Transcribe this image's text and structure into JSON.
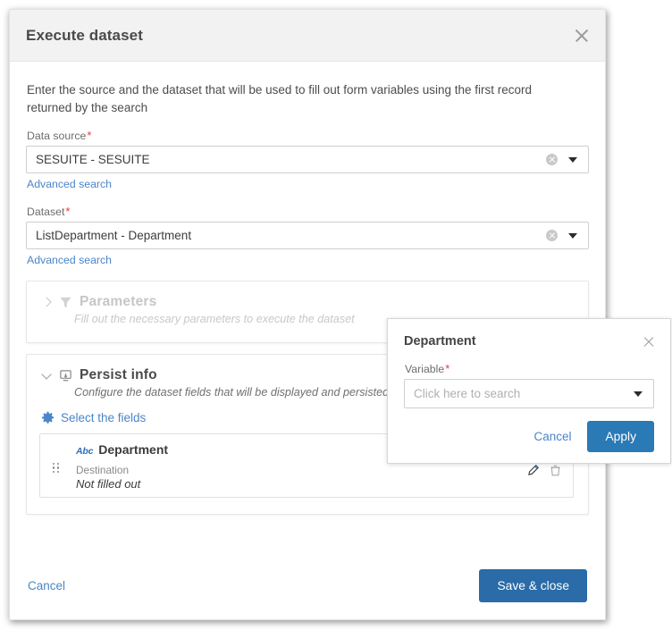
{
  "dialog": {
    "title": "Execute dataset",
    "close_icon": "close-icon",
    "intro": "Enter the source and the dataset that will be used to fill out form variables using the first record returned by the search",
    "fields": [
      {
        "label": "Data source",
        "required": "*",
        "value": "SESUITE - SESUITE",
        "clear_icon": "clear-circle-icon",
        "caret_icon": "chevron-down-icon",
        "advanced_search": "Advanced search"
      },
      {
        "label": "Dataset",
        "required": "*",
        "value": "ListDepartment - Department",
        "clear_icon": "clear-circle-icon",
        "caret_icon": "chevron-down-icon",
        "advanced_search": "Advanced search"
      }
    ],
    "sections": [
      {
        "title": "Parameters",
        "subtitle": "Fill out the necessary parameters to execute the dataset",
        "icon": "filter-icon",
        "chevron": "chevron-right-icon",
        "state": "collapsed-disabled"
      },
      {
        "title": "Persist info",
        "subtitle": "Configure the dataset fields that will be displayed and persisted",
        "icon": "persist-info-icon",
        "chevron": "chevron-down-icon",
        "state": "expanded",
        "select_fields_label": "Select the fields",
        "select_fields_icon": "gear-icon",
        "cards": [
          {
            "type_icon": "abc-icon",
            "type_label": "Abc",
            "title": "Department",
            "meta_label": "Destination",
            "meta_value": "Not filled out",
            "drag_icon": "drag-handle-icon",
            "edit_icon": "pencil-icon",
            "delete_icon": "trash-icon"
          }
        ]
      }
    ],
    "footer": {
      "cancel_label": "Cancel",
      "save_label": "Save & close"
    }
  },
  "popup": {
    "title": "Department",
    "close_icon": "close-icon",
    "field": {
      "label": "Variable",
      "required": "*",
      "value": "",
      "placeholder": "Click here to search",
      "caret_icon": "chevron-down-icon"
    },
    "cancel_label": "Cancel",
    "apply_label": "Apply"
  },
  "colors": {
    "accent_blue": "#2a6ba8",
    "link_blue": "#4a86c8",
    "popup_blue": "#2a7ab5",
    "required_red": "#e03c3c",
    "header_gray": "#f2f2f2"
  }
}
